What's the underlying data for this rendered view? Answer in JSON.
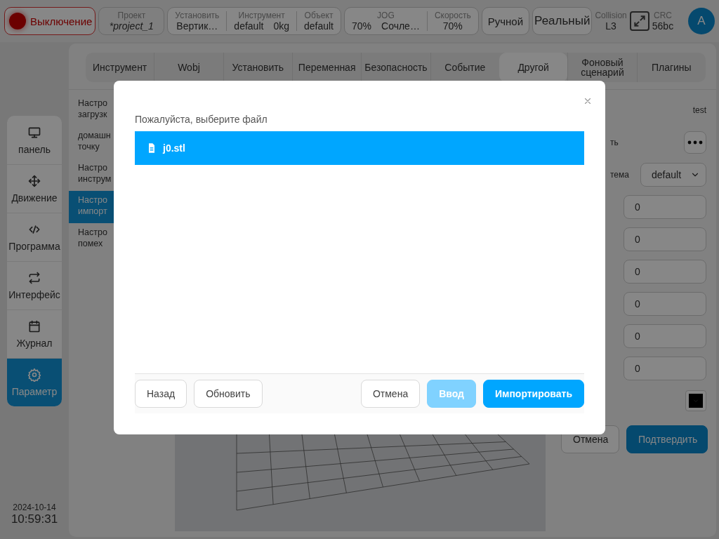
{
  "top_bar": {
    "power": {
      "label": "Выключение",
      "on": false
    },
    "project": {
      "caption": "Проект",
      "value": "*project_1"
    },
    "groups": [
      {
        "fields": [
          {
            "caption": "Установить",
            "values": [
              "Вертик…"
            ]
          },
          {
            "caption": "Инструмент",
            "values": [
              "default",
              "0kg"
            ]
          },
          {
            "caption": "Объект",
            "values": [
              "default"
            ]
          }
        ]
      },
      {
        "fields": [
          {
            "caption": "JOG",
            "values": [
              "70%",
              "Сочле…"
            ]
          },
          {
            "caption": "Скорость",
            "values": [
              "70%"
            ]
          }
        ]
      }
    ],
    "mode": "Ручной",
    "target": "Реальный",
    "collision": {
      "caption": "Collision",
      "value": "L3"
    },
    "crc": {
      "caption": "CRC",
      "value": "56bc"
    },
    "avatar": "A"
  },
  "nav": [
    {
      "label": "панель",
      "kind": "monitor",
      "selected": false
    },
    {
      "label": "Движение",
      "kind": "move",
      "selected": false
    },
    {
      "label": "Программа",
      "kind": "code",
      "selected": false
    },
    {
      "label": "Интерфейс",
      "kind": "swap",
      "selected": false
    },
    {
      "label": "Журнал",
      "kind": "calendar",
      "selected": false
    },
    {
      "label": "Параметр",
      "kind": "gear",
      "selected": true
    }
  ],
  "clock": {
    "date": "2024-10-14",
    "time": "10:59:31"
  },
  "tabs": [
    {
      "label": "Инструмент",
      "selected": false
    },
    {
      "label": "Wobj",
      "selected": false
    },
    {
      "label": "Установить",
      "selected": false
    },
    {
      "label": "Переменная",
      "selected": false
    },
    {
      "label": "Безопасность",
      "selected": false
    },
    {
      "label": "Событие",
      "selected": false
    },
    {
      "label": "Другой",
      "selected": true
    },
    {
      "label": "Фоновый сценарий",
      "selected": false
    },
    {
      "label": "Плагины",
      "selected": false
    }
  ],
  "settings_list": [
    {
      "lines": [
        "Настро",
        "загрузк"
      ],
      "selected": false
    },
    {
      "lines": [
        "домашн",
        "точку"
      ],
      "selected": false
    },
    {
      "lines": [
        "Настро",
        "инструм"
      ],
      "selected": false
    },
    {
      "lines": [
        "Настро",
        "импорт"
      ],
      "selected": true
    },
    {
      "lines": [
        "Настро",
        "помех"
      ],
      "selected": false
    }
  ],
  "form": {
    "rows": [
      {
        "kind": "text",
        "value": "test"
      },
      {
        "kind": "menu",
        "label": "ть"
      },
      {
        "kind": "select",
        "label": "тема",
        "value": "default"
      },
      {
        "kind": "input",
        "value": "0"
      },
      {
        "kind": "input",
        "value": "0"
      },
      {
        "kind": "input",
        "value": "0"
      },
      {
        "kind": "input",
        "value": "0"
      },
      {
        "kind": "input",
        "value": "0"
      },
      {
        "kind": "input",
        "value": "0"
      },
      {
        "kind": "color",
        "color": "#000000"
      }
    ],
    "buttons": [
      {
        "label": "Отмена",
        "kind": "default"
      },
      {
        "label": "Подтвердить",
        "kind": "primary"
      }
    ]
  },
  "dialog": {
    "title": "Пожалуйста, выберите файл",
    "files": [
      {
        "name": "j0.stl",
        "selected": true
      }
    ],
    "left_buttons": [
      {
        "label": "Назад",
        "kind": "default",
        "disabled": false
      },
      {
        "label": "Обновить",
        "kind": "default",
        "disabled": false
      }
    ],
    "right_buttons": [
      {
        "label": "Отмена",
        "kind": "default",
        "disabled": false
      },
      {
        "label": "Ввод",
        "kind": "primary",
        "disabled": true
      },
      {
        "label": "Импортировать",
        "kind": "primary",
        "disabled": false
      }
    ]
  }
}
